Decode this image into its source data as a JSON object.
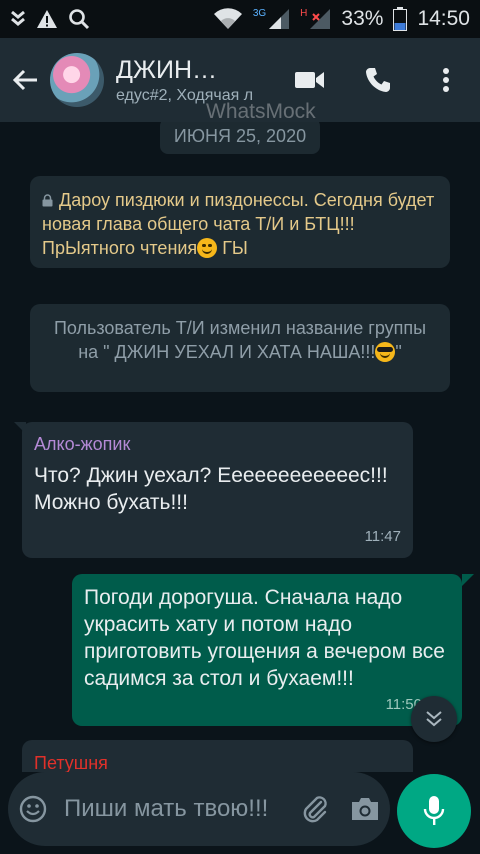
{
  "status_bar": {
    "net1": "3G",
    "net2": "H",
    "battery_percent": "33%",
    "time": "14:50"
  },
  "header": {
    "title": "ДЖИН…",
    "subtitle": "едус#2, Ходячая л",
    "watermark": "WhatsMock"
  },
  "chat": {
    "date_chip": "ИЮНЯ 25, 2020",
    "system_encrypted": "Дароу пиздюки и пиздонессы. Сегодня будет новая глава общего чата Т/И и БТЦ!!! ПрЫятного чтения",
    "system_encrypted_tail": " ГЫ",
    "system_rename": "Пользователь Т/И изменил название группы на \" ДЖИН УЕХАЛ И ХАТА НАША!!!",
    "system_rename_tail": "\"",
    "messages": [
      {
        "sender": "Алко-жопик",
        "text": "Что? Джин уехал? Еееееееееееес!!! Можно бухать!!!",
        "time": "11:47"
      },
      {
        "text": "Погоди дорогуша. Сначала надо украсить хату и потом надо приготовить угощения  а вечером все садимся за стол и бухаем!!!",
        "time": "11:50"
      },
      {
        "sender": "Петушня"
      }
    ]
  },
  "composer": {
    "placeholder": "Пиши мать твою!!!"
  },
  "colors": {
    "header_bg": "#1f2c34",
    "chat_bg": "#0b141a",
    "incoming_bubble": "#1f2c34",
    "outgoing_bubble": "#005c4b",
    "accent_green": "#00a884",
    "system_text_yellow": "#e4c98a"
  }
}
